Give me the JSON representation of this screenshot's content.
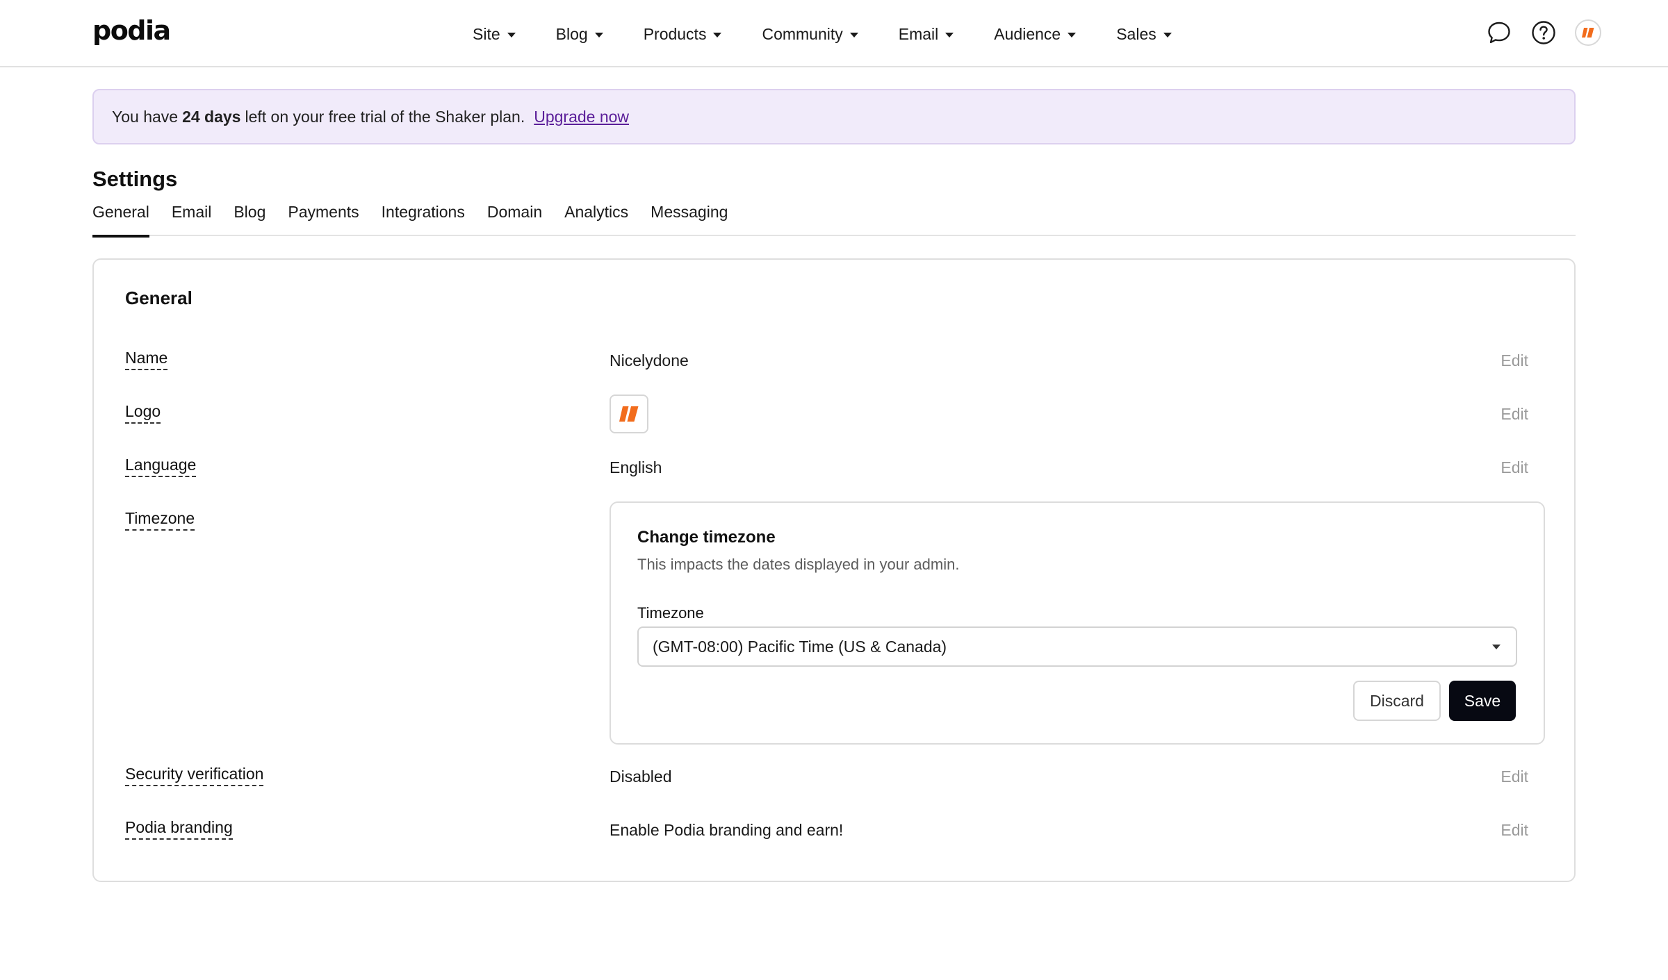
{
  "brand": {
    "name": "podia"
  },
  "nav": {
    "items": [
      {
        "label": "Site"
      },
      {
        "label": "Blog"
      },
      {
        "label": "Products"
      },
      {
        "label": "Community"
      },
      {
        "label": "Email"
      },
      {
        "label": "Audience"
      },
      {
        "label": "Sales"
      }
    ],
    "icons": [
      "chat-icon",
      "help-icon",
      "account-avatar"
    ]
  },
  "banner": {
    "prefix": "You have",
    "days": "24 days",
    "suffix": "left on your free trial of the Shaker plan.",
    "link": "Upgrade now"
  },
  "settings": {
    "title": "Settings",
    "tabs": [
      {
        "label": "General"
      },
      {
        "label": "Email"
      },
      {
        "label": "Blog"
      },
      {
        "label": "Payments"
      },
      {
        "label": "Integrations"
      },
      {
        "label": "Domain"
      },
      {
        "label": "Analytics"
      },
      {
        "label": "Messaging"
      }
    ],
    "active_tab": "General"
  },
  "general": {
    "title": "General",
    "edit_label": "Edit",
    "rows": {
      "name": {
        "label": "Name",
        "value": "Nicelydone"
      },
      "logo": {
        "label": "Logo"
      },
      "language": {
        "label": "Language",
        "value": "English"
      },
      "timezone": {
        "label": "Timezone"
      },
      "security": {
        "label": "Security verification",
        "value": "Disabled"
      },
      "branding": {
        "label": "Podia branding",
        "value": "Enable Podia branding and earn!"
      }
    },
    "timezone_panel": {
      "title": "Change timezone",
      "description": "This impacts the dates displayed in your admin.",
      "field_label": "Timezone",
      "selected": "(GMT-08:00) Pacific Time (US & Canada)",
      "discard": "Discard",
      "save": "Save"
    }
  },
  "colors": {
    "brand_orange": "#f26c1c",
    "banner_bg": "#f1ebfa",
    "link_purple": "#5b1e99",
    "primary_button": "#070912"
  }
}
